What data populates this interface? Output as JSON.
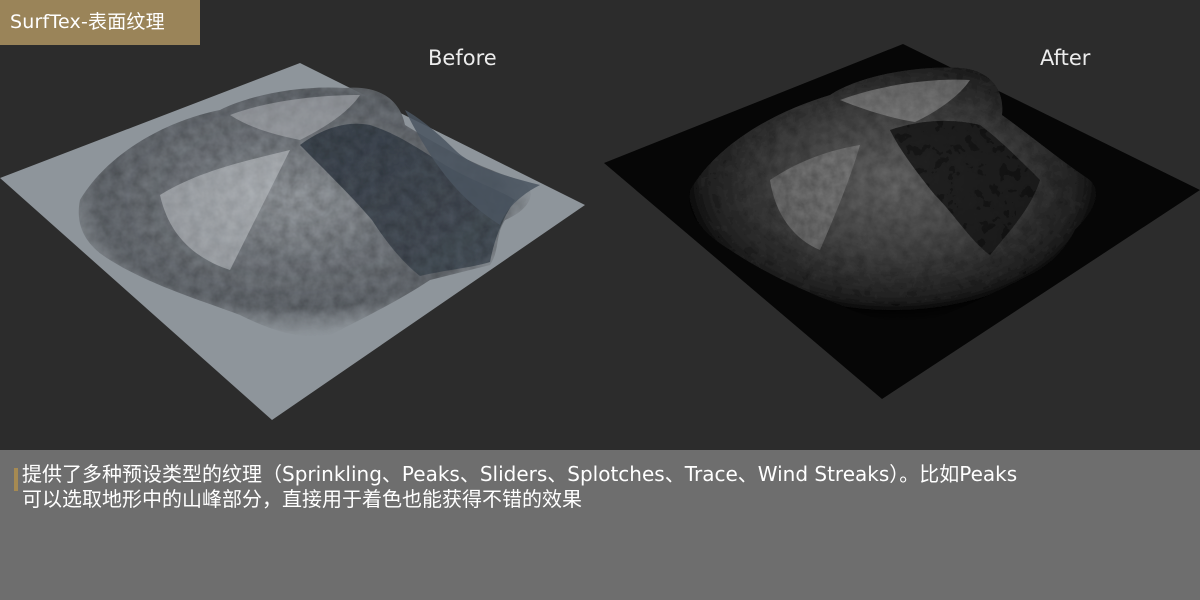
{
  "badge": {
    "title": "SurfTex-表面纹理"
  },
  "panels": {
    "before_label": "Before",
    "after_label": "After"
  },
  "caption": {
    "line1": "提供了多种预设类型的纹理（Sprinkling、Peaks、Sliders、Splotches、Trace、Wind Streaks）。比如Peaks",
    "line2": "可以选取地形中的山峰部分，直接用于着色也能获得不错的效果"
  },
  "colors": {
    "badge_bg": "#9a8459",
    "caption_bg": "#6e6e6e",
    "accent_bar": "#a68a52",
    "stage_bg": "#2c2c2c"
  }
}
